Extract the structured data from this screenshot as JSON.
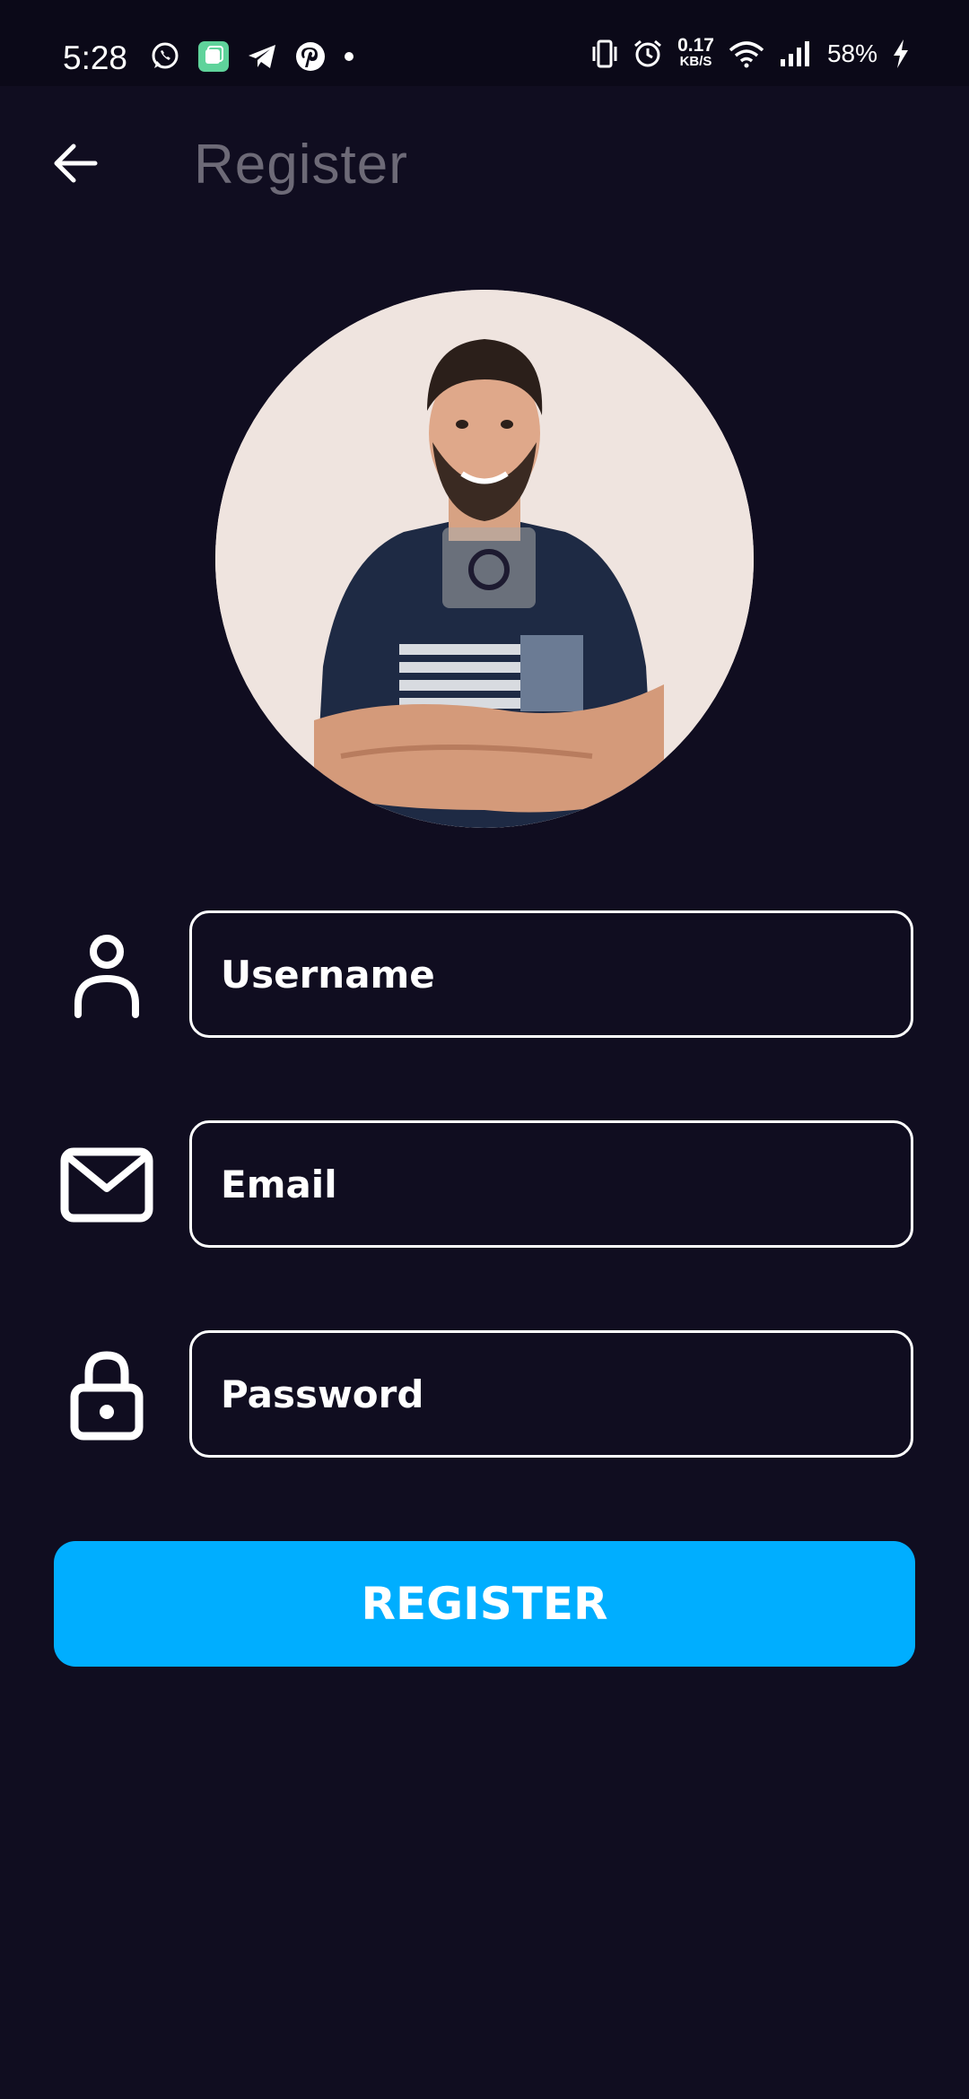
{
  "status_bar": {
    "time": "5:28",
    "left_icons": [
      "whatsapp-icon",
      "app-icon",
      "telegram-icon",
      "pinterest-icon",
      "dot-icon"
    ],
    "net_speed_value": "0.17",
    "net_speed_unit": "KB/S",
    "battery": "58%",
    "right_icons": [
      "vibrate-icon",
      "alarm-icon",
      "wifi-icon",
      "signal-icon",
      "charging-icon"
    ]
  },
  "app_bar": {
    "title": "Register",
    "back_icon": "arrow-left-icon"
  },
  "avatar": {
    "camera_icon": "camera-icon"
  },
  "form": {
    "username": {
      "placeholder": "Username",
      "value": "",
      "icon": "person-icon"
    },
    "email": {
      "placeholder": "Email",
      "value": "",
      "icon": "mail-icon"
    },
    "password": {
      "placeholder": "Password",
      "value": "",
      "icon": "lock-icon"
    }
  },
  "register_button": {
    "label": "REGISTER"
  },
  "colors": {
    "background": "#100d20",
    "status_bar": "#0b0918",
    "accent": "#00aeff",
    "title": "#6d6a77",
    "field_border": "#ffffff"
  }
}
